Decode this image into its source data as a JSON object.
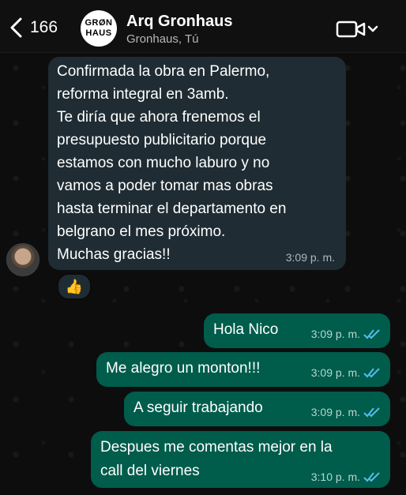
{
  "header": {
    "back_count": "166",
    "group_avatar_line1": "GRØN",
    "group_avatar_line2": "HAUS",
    "chat_name": "Arq Gronhaus",
    "participants": "Gronhaus, Tú"
  },
  "incoming_message": {
    "lines": [
      "Confirmada la obra en Palermo,",
      "reforma integral en 3amb.",
      "Te diría que ahora frenemos el",
      "presupuesto publicitario porque",
      "estamos con mucho laburo y no",
      "vamos a poder tomar mas obras",
      "hasta terminar el departamento en",
      "belgrano el mes próximo.",
      "Muchas gracias!!"
    ],
    "time": "3:09 p. m.",
    "reaction": "👍"
  },
  "outgoing_messages": [
    {
      "text": "Hola Nico",
      "time": "3:09 p. m."
    },
    {
      "text": "Me alegro un monton!!!",
      "time": "3:09 p. m."
    },
    {
      "text": "A seguir trabajando",
      "time": "3:09 p. m."
    },
    {
      "line1": "Despues me comentas mejor en la",
      "line2": "call del viernes",
      "time": "3:10 p. m."
    }
  ],
  "colors": {
    "incoming_bubble": "#1f2c33",
    "outgoing_bubble": "#005c4b",
    "read_ticks": "#53bdeb"
  },
  "icons": [
    "back-chevron-icon",
    "video-call-icon",
    "chevron-down-icon",
    "double-check-icon"
  ]
}
